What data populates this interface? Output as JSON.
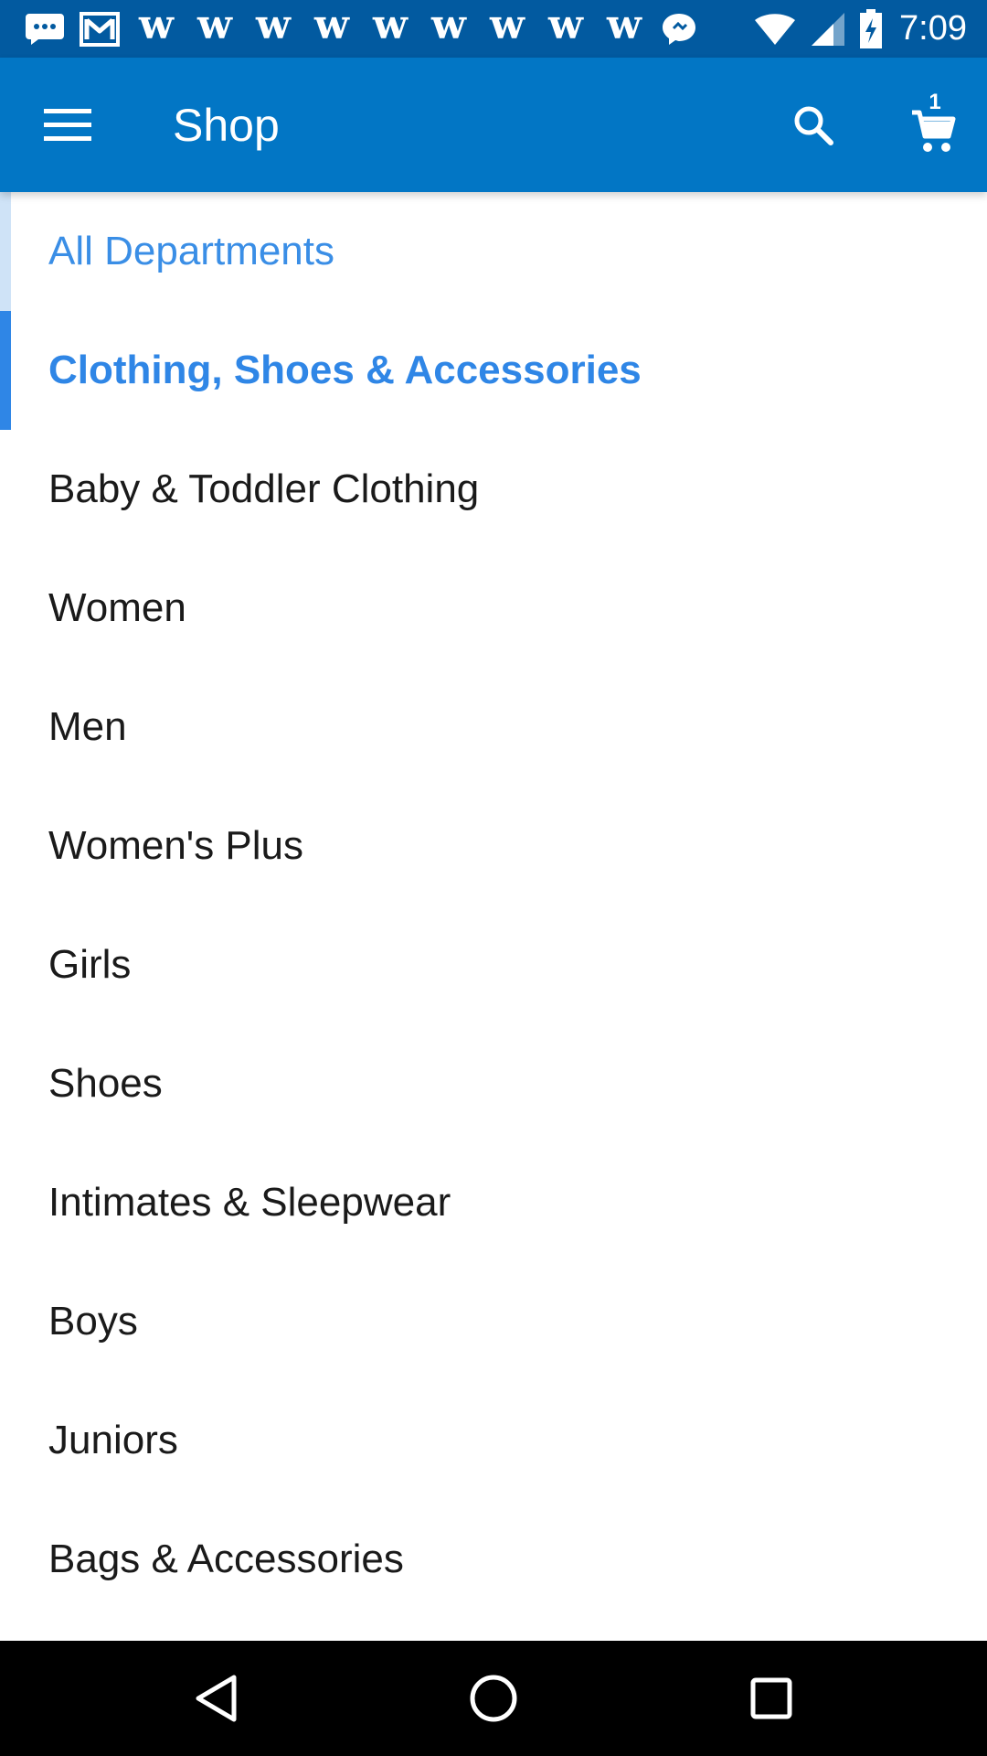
{
  "status_bar": {
    "left_icons": [
      "chat-bubble-icon",
      "gmail-icon",
      "w-icon",
      "w-icon",
      "w-icon",
      "w-icon",
      "w-icon",
      "w-icon",
      "w-icon",
      "w-icon",
      "w-icon",
      "messenger-icon"
    ],
    "w_glyph": "w",
    "time": "7:09"
  },
  "app_bar": {
    "title": "Shop",
    "cart_count": "1",
    "background": "#0276c5"
  },
  "departments": {
    "all_label": "All Departments",
    "selected_label": "Clothing, Shoes & Accessories",
    "items": [
      "Baby & Toddler Clothing",
      "Women",
      "Men",
      "Women's Plus",
      "Girls",
      "Shoes",
      "Intimates & Sleepwear",
      "Boys",
      "Juniors",
      "Bags & Accessories"
    ]
  },
  "colors": {
    "status_bar": "#025aa0",
    "accent": "#2f86e6",
    "text": "#1a1a1a"
  }
}
